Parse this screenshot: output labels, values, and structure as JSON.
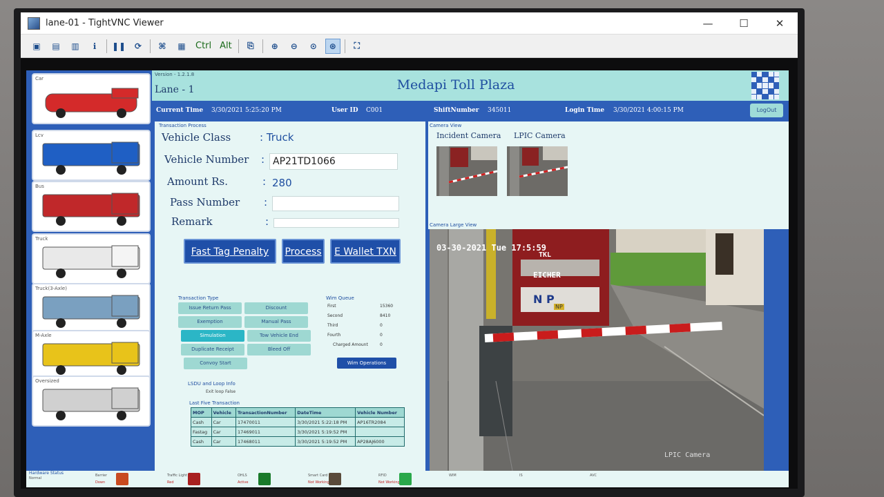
{
  "window": {
    "title": "lane-01 - TightVNC Viewer",
    "minimize": "—",
    "maximize": "☐",
    "close": "✕"
  },
  "toolbar": {
    "ctrl_label": "Ctrl",
    "alt_label": "Alt"
  },
  "header": {
    "version": "Version -  1.2.1.8",
    "lane": "Lane -  1",
    "plaza": "Medapi Toll Plaza"
  },
  "infobar": {
    "current_time_label": "Current Time",
    "current_time": "3/30/2021 5:25:20 PM",
    "user_id_label": "User ID",
    "user_id": "C001",
    "shift_label": "ShiftNumber",
    "shift": "345011",
    "login_label": "Login Time",
    "login_time": "3/30/2021 4:00:15 PM",
    "logout": "LogOut"
  },
  "vehicles": [
    {
      "label": "Car",
      "color": "#d42a2a"
    },
    {
      "label": "Lcv",
      "color": "#1f5fc4"
    },
    {
      "label": "Bus",
      "color": "#c0282a"
    },
    {
      "label": "Truck",
      "color": "#e9e9e9"
    },
    {
      "label": "Truck(3-Axle)",
      "color": "#7aa0c0"
    },
    {
      "label": "M-Axle",
      "color": "#e8c31a"
    },
    {
      "label": "Oversized",
      "color": "#d0d0d0"
    }
  ],
  "transaction": {
    "section": "Transaction Process",
    "vehicle_class_label": "Vehicle Class",
    "vehicle_class": ": Truck",
    "vehicle_number_label": "Vehicle Number",
    "vehicle_number": "AP21TD1066",
    "amount_label": "Amount Rs.",
    "amount": "280",
    "pass_label": "Pass Number",
    "remark_label": "Remark",
    "colon": ":",
    "buttons": {
      "fast_tag": "Fast Tag Penalty",
      "process": "Process",
      "ewallet": "E Wallet TXN"
    }
  },
  "transaction_type": {
    "section": "Transaction Type",
    "buttons": [
      "Issue Return Pass",
      "Discount",
      "Exemption",
      "Manual Pass",
      "Simulation",
      "Tow Vehicle End",
      "Duplicate Receipt",
      "Bleed Off",
      "Convoy Start"
    ],
    "selected": "Simulation"
  },
  "wim": {
    "section": "Wim Queue",
    "rows": [
      {
        "label": "First",
        "value": "15360"
      },
      {
        "label": "Second",
        "value": "8410"
      },
      {
        "label": "Third",
        "value": "0"
      },
      {
        "label": "Fourth",
        "value": "0"
      },
      {
        "label": "Charged Amount",
        "value": "0"
      }
    ],
    "button": "Wim Operations"
  },
  "lsdu": {
    "section": "LSDU and Loop Info",
    "text": "Exit loop False"
  },
  "last_five": {
    "section": "Last Five Transaction",
    "columns": [
      "MOP",
      "Vehicle",
      "TransactionNumber",
      "DateTime",
      "Vehicle Number"
    ],
    "rows": [
      [
        "Cash",
        "Car",
        "17470011",
        "3/30/2021 5:22:18 PM",
        "AP16TR2084"
      ],
      [
        "Fastag",
        "Car",
        "17469011",
        "3/30/2021 5:19:52 PM",
        ""
      ],
      [
        "Cash",
        "Car",
        "17468011",
        "3/30/2021 5:19:52 PM",
        "AP28AJ6000"
      ]
    ]
  },
  "camera": {
    "section": "Camera View",
    "incident_label": "Incident Camera",
    "lpic_label": "LPIC Camera",
    "large_section": "Camera Large View",
    "overlay_time": "03-30-2021 Tue 17:5:59",
    "overlay_name": "LPIC Camera",
    "truck_brand": "EICHER",
    "truck_top": "TKL",
    "truck_plate": "N  P",
    "truck_bumper": "NP"
  },
  "hardware": {
    "section": "Hardware Status",
    "normal": "Normal",
    "items": [
      {
        "name": "Barrier",
        "state": "Down"
      },
      {
        "name": "Traffic Light",
        "state": "Red"
      },
      {
        "name": "OHLS",
        "state": "Active"
      },
      {
        "name": "Smart Card",
        "state": "Not Working"
      },
      {
        "name": "RFID",
        "state": "Not Working"
      },
      {
        "name": "WIM",
        "state": ""
      },
      {
        "name": "IS",
        "state": ""
      },
      {
        "name": "AVC",
        "state": ""
      }
    ]
  }
}
